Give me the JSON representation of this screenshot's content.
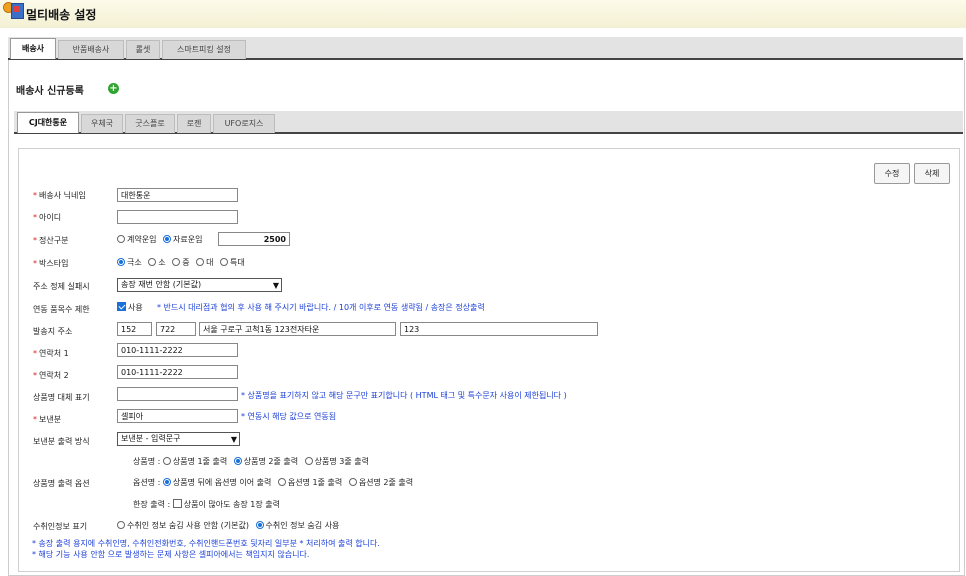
{
  "window": {
    "title": "멀티배송 설정"
  },
  "main_tabs": [
    {
      "label": "배송사",
      "active": true
    },
    {
      "label": "반품배송사",
      "active": false
    },
    {
      "label": "롤셋",
      "active": false
    },
    {
      "label": "스마트피킹 설정",
      "active": false
    }
  ],
  "section": {
    "title": "배송사 신규등록",
    "add_icon": "plus-circle-icon",
    "add_symbol": "+"
  },
  "carrier_tabs": [
    {
      "label": "CJ대한통운",
      "active": true
    },
    {
      "label": "우체국",
      "active": false
    },
    {
      "label": "굿스플로",
      "active": false
    },
    {
      "label": "로젠",
      "active": false
    },
    {
      "label": "UFO로지스",
      "active": false
    }
  ],
  "buttons": {
    "edit": "수정",
    "delete": "삭제"
  },
  "required_mark": "*",
  "form": {
    "nickname": {
      "label": "배송사 닉네임",
      "value": "대한통운"
    },
    "user_id": {
      "label": "아이디",
      "value": ""
    },
    "fare_type": {
      "label": "정산구분",
      "options": [
        "계약운임",
        "자료운임"
      ],
      "selected": "자료운임",
      "amount": "2500"
    },
    "box_type": {
      "label": "박스타입",
      "options": [
        "극소",
        "소",
        "중",
        "대",
        "특대"
      ],
      "selected": "극소"
    },
    "address_failure": {
      "label": "주소 정제 실패시",
      "selected": "송장 재번 안함 (기본값)"
    },
    "item_limit": {
      "label": "연동 품목수 제한",
      "checkbox_label": "사용",
      "checked": true,
      "note": "* 반드시 대리점과 협의 후 사용 해 주시기 바랍니다. / 10개 이후로 연동 생략됨 / 송장은 정상출력"
    },
    "sender_address": {
      "label": "발송지 주소",
      "zip1": "152",
      "zip2": "722",
      "address": "서울 구로구 고척1동 123전자타운",
      "detail": "123"
    },
    "phone1": {
      "label": "연락처 1",
      "value": "010-1111-2222"
    },
    "phone2": {
      "label": "연락처 2",
      "value": "010-1111-2222"
    },
    "product_alt": {
      "label": "상품명 대체 표기",
      "value": "",
      "note": "* 상품명을 표기하지 않고 해당 문구만 표기합니다 ( HTML 태그 및 특수문자 사용이 제한됩니다 )"
    },
    "sender_name": {
      "label": "보낸분",
      "value": "셀피아",
      "note": "* 연동시 해당 값으로 연동됨"
    },
    "sender_print": {
      "label": "보낸분 출력 방식",
      "selected": "보낸분 - 입력문구"
    },
    "product_output": {
      "label": "상품명 출력 옵션",
      "product_line": {
        "prefix": "상품명 :",
        "options": [
          "상품명 1줄 출력",
          "상품명 2줄 출력",
          "상품명 3줄 출력"
        ],
        "selected": "상품명 2줄 출력"
      },
      "option_line": {
        "prefix": "옵션명 :",
        "options": [
          "상품명 뒤에 옵션명 이어 출력",
          "옵션명 1줄 출력",
          "옵션명 2줄 출력"
        ],
        "selected": "상품명 뒤에 옵션명 이어 출력"
      },
      "single_line": {
        "prefix": "한장 출력 :",
        "checkbox_label": "상품이 많아도 송장 1장 출력",
        "checked": false
      }
    },
    "recipient_info": {
      "label": "수취인정보 표기",
      "options": [
        "수취인 정보 숨김 사용 안함 (기본값)",
        "수취인 정보 숨김 사용"
      ],
      "selected": "수취인 정보 숨김 사용"
    },
    "footnotes": [
      "* 송장 출력 용지에 수취인명, 수취인전화번호, 수취인핸드폰번호 뒷자리 일부분 * 처리하여 출력 합니다.",
      "* 해당 기능 사용 안함 으로 발생하는 문제 사항은 셀피아에서는 책임지지 않습니다."
    ]
  }
}
